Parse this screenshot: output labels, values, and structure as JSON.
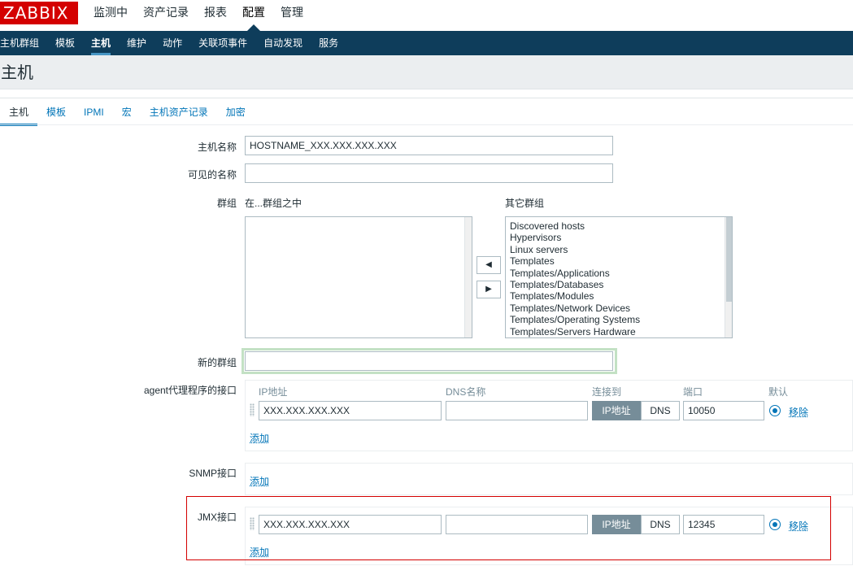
{
  "logo": "ZABBIX",
  "top_menu": [
    "监测中",
    "资产记录",
    "报表",
    "配置",
    "管理"
  ],
  "sub_menu": [
    "主机群组",
    "模板",
    "主机",
    "维护",
    "动作",
    "关联项事件",
    "自动发现",
    "服务"
  ],
  "page_title": "主机",
  "tabs": [
    "主机",
    "模板",
    "IPMI",
    "宏",
    "主机资产记录",
    "加密"
  ],
  "form": {
    "host_name_label": "主机名称",
    "host_name_value": "HOSTNAME_XXX.XXX.XXX.XXX",
    "visible_name_label": "可见的名称",
    "visible_name_value": "",
    "groups_label": "群组",
    "in_groups_label": "在...群组之中",
    "other_groups_label": "其它群组",
    "in_groups": [],
    "other_groups": [
      "Discovered hosts",
      "Hypervisors",
      "Linux servers",
      "Templates",
      "Templates/Applications",
      "Templates/Databases",
      "Templates/Modules",
      "Templates/Network Devices",
      "Templates/Operating Systems",
      "Templates/Servers Hardware"
    ],
    "move_left_button": "◀",
    "move_right_button": "▶",
    "new_group_label": "新的群组",
    "new_group_value": "",
    "agent_label": "agent代理程序的接口",
    "columns": {
      "ip": "IP地址",
      "dns": "DNS名称",
      "connect_to": "连接到",
      "port": "端口",
      "default": "默认"
    },
    "agent_interface": {
      "ip": "XXX.XXX.XXX.XXX",
      "dns": "",
      "connect_ip": "IP地址",
      "connect_dns": "DNS",
      "port": "10050",
      "remove": "移除"
    },
    "add_link": "添加",
    "snmp_label": "SNMP接口",
    "jmx_label": "JMX接口",
    "jmx_interface": {
      "ip": "XXX.XXX.XXX.XXX",
      "dns": "",
      "connect_ip": "IP地址",
      "connect_dns": "DNS",
      "port": "12345",
      "remove": "移除"
    }
  },
  "colors": {
    "brand": "#d40000",
    "nav_bg": "#0e3d5b",
    "link": "#0275b8",
    "highlight_box": "#d40000"
  }
}
